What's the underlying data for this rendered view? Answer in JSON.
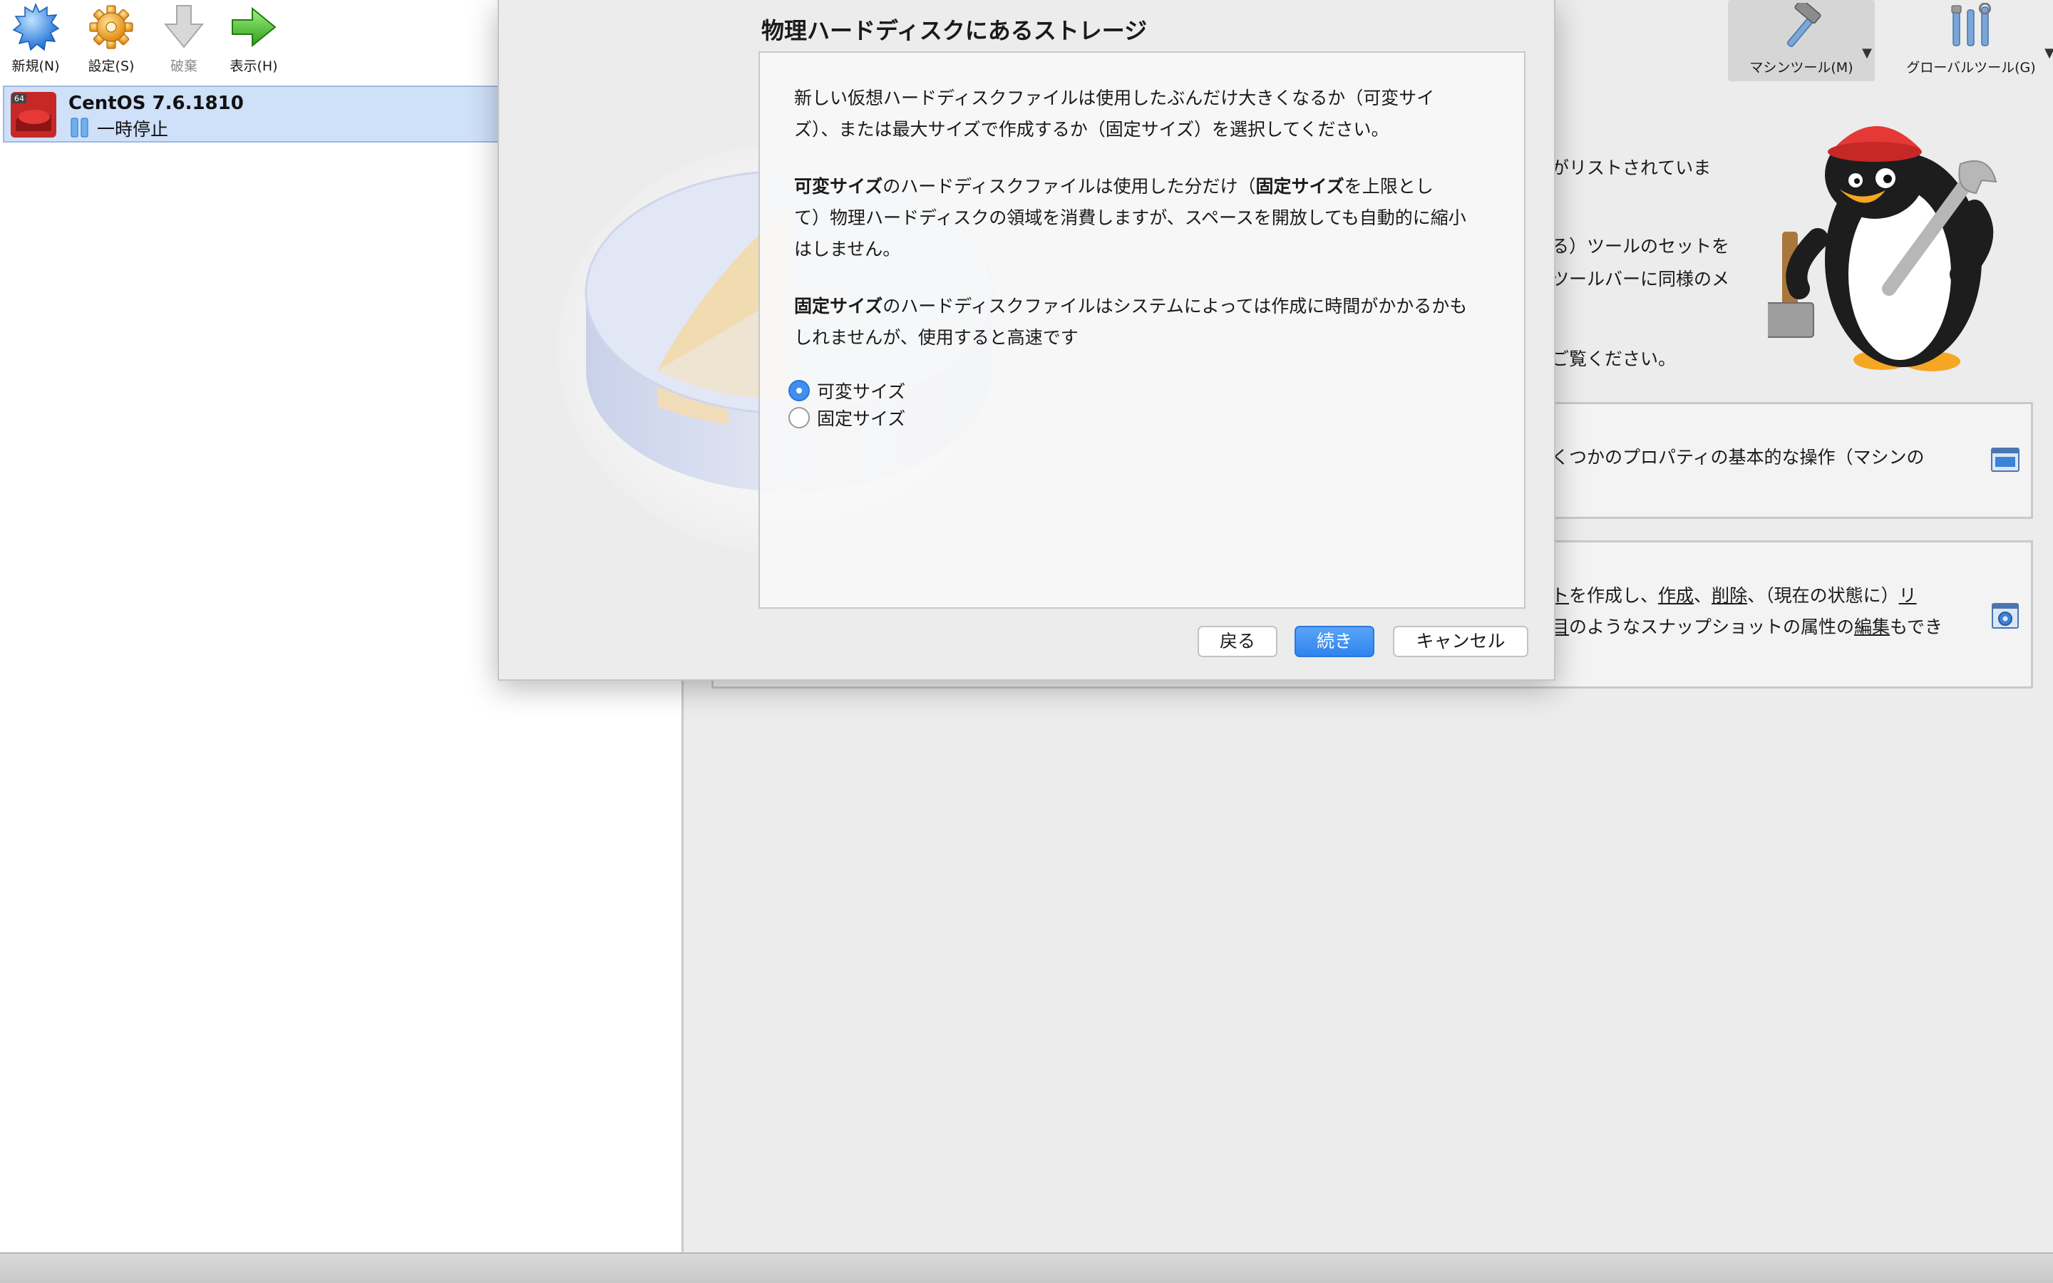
{
  "toolbar": {
    "new_label": "新規(N)",
    "settings_label": "設定(S)",
    "discard_label": "破棄",
    "show_label": "表示(H)"
  },
  "vm": {
    "name": "CentOS 7.6.1810",
    "state": "一時停止",
    "badge": "64"
  },
  "right_toolbar": {
    "machine_tools_label": "マシンツール(M)",
    "global_tools_label": "グローバルツール(G)",
    "dropdown_glyph": "▼"
  },
  "welcome": {
    "line1": "がリストされていま",
    "line2": "る）ツールのセットを",
    "line3": "ツールバーに同様のメ",
    "line4": "ご覧ください。"
  },
  "cards": {
    "details_line1": "くつかのプロパティの基本的な操作（マシンの",
    "snap_line1_a": "ト",
    "snap_line1_b": "を作成し、",
    "snap_line1_c": "作成",
    "snap_line1_d": "、",
    "snap_line1_e": "削除",
    "snap_line1_f": "、（現在の状態に）",
    "snap_line1_g": "リ",
    "snap_line2_a": "目",
    "snap_line2_b": "のようなスナップショットの属性の",
    "snap_line2_c": "編集",
    "snap_line2_d": "もでき"
  },
  "dialog": {
    "title": "物理ハードディスクにあるストレージ",
    "intro_line1": "新しい仮想ハードディスクファイルは使用したぶんだけ大きくなるか（可変サイ",
    "intro_line2": "ズ）、または最大サイズで作成するか（固定サイズ）を選択してください。",
    "dyn_bold1": "可変サイズ",
    "dyn_t1": "のハードディスクファイルは使用した分だけ（",
    "dyn_bold2": "固定サイズ",
    "dyn_t2": "を上限とし",
    "dyn_line2": "て）物理ハードディスクの領域を消費しますが、スペースを開放しても自動的に縮小",
    "dyn_line3": "はしません。",
    "fix_bold": "固定サイズ",
    "fix_t1": "のハードディスクファイルはシステムによっては作成に時間がかかるかも",
    "fix_line2": "しれませんが、使用すると高速です",
    "option_dynamic": "可変サイズ",
    "option_fixed": "固定サイズ",
    "selected_option": "可変サイズ",
    "back_label": "戻る",
    "continue_label": "続き",
    "cancel_label": "キャンセル"
  },
  "colors": {
    "accent": "#2f84ee",
    "selection": "#cfe0f9",
    "background": "#ececec"
  }
}
